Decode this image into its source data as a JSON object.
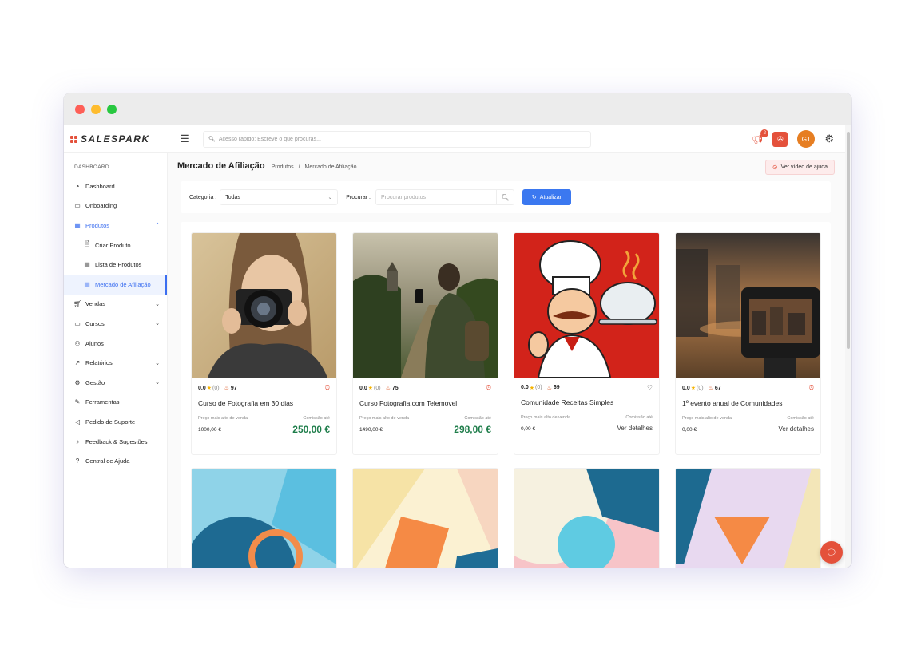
{
  "header": {
    "logo_text": "SALESPARK",
    "search_placeholder": "Acesso rápido: Escreve o que procuras...",
    "notifications_count": "2",
    "avatar_initials": "GT"
  },
  "sidebar": {
    "section": "DASHBOARD",
    "items": [
      {
        "label": "Dashboard"
      },
      {
        "label": "Onboarding"
      },
      {
        "label": "Produtos"
      },
      {
        "label": "Criar Produto"
      },
      {
        "label": "Lista de Produtos"
      },
      {
        "label": "Mercado de Afiliação"
      },
      {
        "label": "Vendas"
      },
      {
        "label": "Cursos"
      },
      {
        "label": "Alunos"
      },
      {
        "label": "Relatórios"
      },
      {
        "label": "Gestão"
      },
      {
        "label": "Ferramentas"
      },
      {
        "label": "Pedido de Suporte"
      },
      {
        "label": "Feedback & Sugestões"
      },
      {
        "label": "Central de Ajuda"
      }
    ]
  },
  "page": {
    "title": "Mercado de Afiliação",
    "breadcrumb": [
      "Produtos",
      "/",
      "Mercado de Afiliação"
    ],
    "help_button": "Ver vídeo de ajuda"
  },
  "filters": {
    "category_label": "Categoria :",
    "category_value": "Todas",
    "search_label": "Procurar :",
    "search_placeholder": "Procurar produtos",
    "refresh_label": "Atualizar"
  },
  "products": [
    {
      "rating": "0.0",
      "reviews": "(0)",
      "hot": "97",
      "title": "Curso de Fotografia em 30 dias",
      "price_label": "Preço mais alto de venda",
      "price": "1000,00 €",
      "commission_label": "Comissão até",
      "commission": "250,00 €"
    },
    {
      "rating": "0.0",
      "reviews": "(0)",
      "hot": "75",
      "title": "Curso Fotografia com Telemovel",
      "price_label": "Preço mais alto de venda",
      "price": "1490,00 €",
      "commission_label": "Comissão até",
      "commission": "298,00 €"
    },
    {
      "rating": "0.0",
      "reviews": "(0)",
      "hot": "69",
      "title": "Comunidade Receitas Simples",
      "price_label": "Preço mais alto de venda",
      "price": "0,00 €",
      "commission_label": "Comissão até",
      "commission": "Ver detalhes"
    },
    {
      "rating": "0.0",
      "reviews": "(0)",
      "hot": "67",
      "title": "1º evento anual de Comunidades",
      "price_label": "Preço mais alto de venda",
      "price": "0,00 €",
      "commission_label": "Comissão até",
      "commission": "Ver detalhes"
    }
  ],
  "colors": {
    "accent": "#3b78f0",
    "brand": "#e4513b",
    "commission_green": "#1e7d4a"
  }
}
